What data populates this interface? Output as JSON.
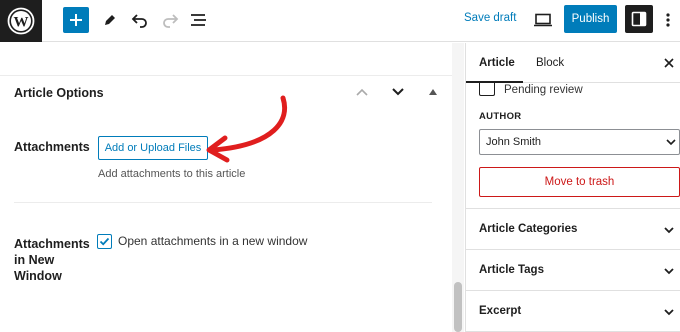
{
  "toolbar": {
    "logo_icon": "wordpress-logo-icon",
    "add_icon": "plus-icon",
    "tools_icon": "pencil-icon",
    "undo_icon": "undo-icon",
    "redo_icon": "redo-icon",
    "list_view_icon": "list-view-icon",
    "save_draft": "Save draft",
    "preview_icon": "desktop-preview-icon",
    "publish": "Publish",
    "settings_icon": "sidebar-toggle-icon",
    "more_icon": "vertical-ellipsis-icon",
    "accent_color": "#007cba"
  },
  "editor": {
    "article_options_title": "Article Options",
    "attachments_label": "Attachments",
    "upload_button": "Add or Upload Files",
    "attachments_help": "Add attachments to this article",
    "new_window_label_lines": [
      "Attachments",
      "in New",
      "Window"
    ],
    "new_window_checkbox": "Open attachments in a new window",
    "new_window_checked": true,
    "annotation_arrow_color": "#e01e1e"
  },
  "sidebar": {
    "tabs": [
      {
        "label": "Article",
        "active": true
      },
      {
        "label": "Block",
        "active": false
      }
    ],
    "pending_review": "Pending review",
    "author_label": "AUTHOR",
    "author_value": "John Smith",
    "move_to_trash": "Move to trash",
    "panels": [
      "Article Categories",
      "Article Tags",
      "Excerpt"
    ],
    "danger_color": "#cc1818"
  }
}
